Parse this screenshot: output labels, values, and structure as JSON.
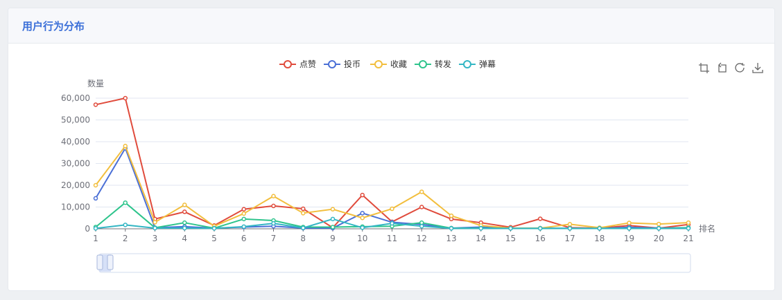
{
  "card": {
    "title": "用户行为分布"
  },
  "colors": {
    "accent": "#3b6fd8",
    "点赞": "#e04b3c",
    "投币": "#4a6fd6",
    "收藏": "#f2be3d",
    "转发": "#2ec48c",
    "弹幕": "#33b6c4"
  },
  "toolbox": [
    "zoom-icon",
    "zoom-reset-icon",
    "restore-icon",
    "download-icon"
  ],
  "chart_data": {
    "type": "line",
    "xlabel": "排名",
    "ylabel": "数量",
    "ylim": [
      0,
      60000
    ],
    "yticks": [
      "0",
      "10,000",
      "20,000",
      "30,000",
      "40,000",
      "50,000",
      "60,000"
    ],
    "categories": [
      "1",
      "2",
      "3",
      "4",
      "5",
      "6",
      "7",
      "8",
      "9",
      "10",
      "11",
      "12",
      "13",
      "14",
      "15",
      "16",
      "17",
      "18",
      "19",
      "20",
      "21"
    ],
    "legend_position": "top-center",
    "grid": true,
    "series": [
      {
        "name": "点赞",
        "values": [
          57000,
          60000,
          4500,
          7800,
          1500,
          9000,
          10500,
          9200,
          500,
          15500,
          3200,
          10000,
          4500,
          2800,
          700,
          4600,
          500,
          300,
          1500,
          300,
          2000
        ]
      },
      {
        "name": "投币",
        "values": [
          14000,
          37000,
          500,
          1000,
          300,
          800,
          1200,
          300,
          300,
          7200,
          3000,
          2000,
          300,
          800,
          200,
          300,
          200,
          200,
          700,
          300,
          500
        ]
      },
      {
        "name": "收藏",
        "values": [
          20000,
          38000,
          3000,
          11000,
          1200,
          7000,
          15000,
          7200,
          9000,
          5000,
          9200,
          17000,
          6000,
          1500,
          300,
          300,
          2100,
          500,
          2700,
          2200,
          2800
        ]
      },
      {
        "name": "转发",
        "values": [
          800,
          12000,
          500,
          2800,
          300,
          4500,
          3800,
          800,
          800,
          1000,
          1200,
          2800,
          300,
          300,
          200,
          200,
          200,
          200,
          200,
          200,
          500
        ]
      },
      {
        "name": "弹幕",
        "values": [
          200,
          1800,
          300,
          300,
          200,
          1000,
          2500,
          400,
          4500,
          500,
          2500,
          1200,
          200,
          200,
          200,
          200,
          200,
          200,
          200,
          200,
          200
        ]
      }
    ]
  }
}
